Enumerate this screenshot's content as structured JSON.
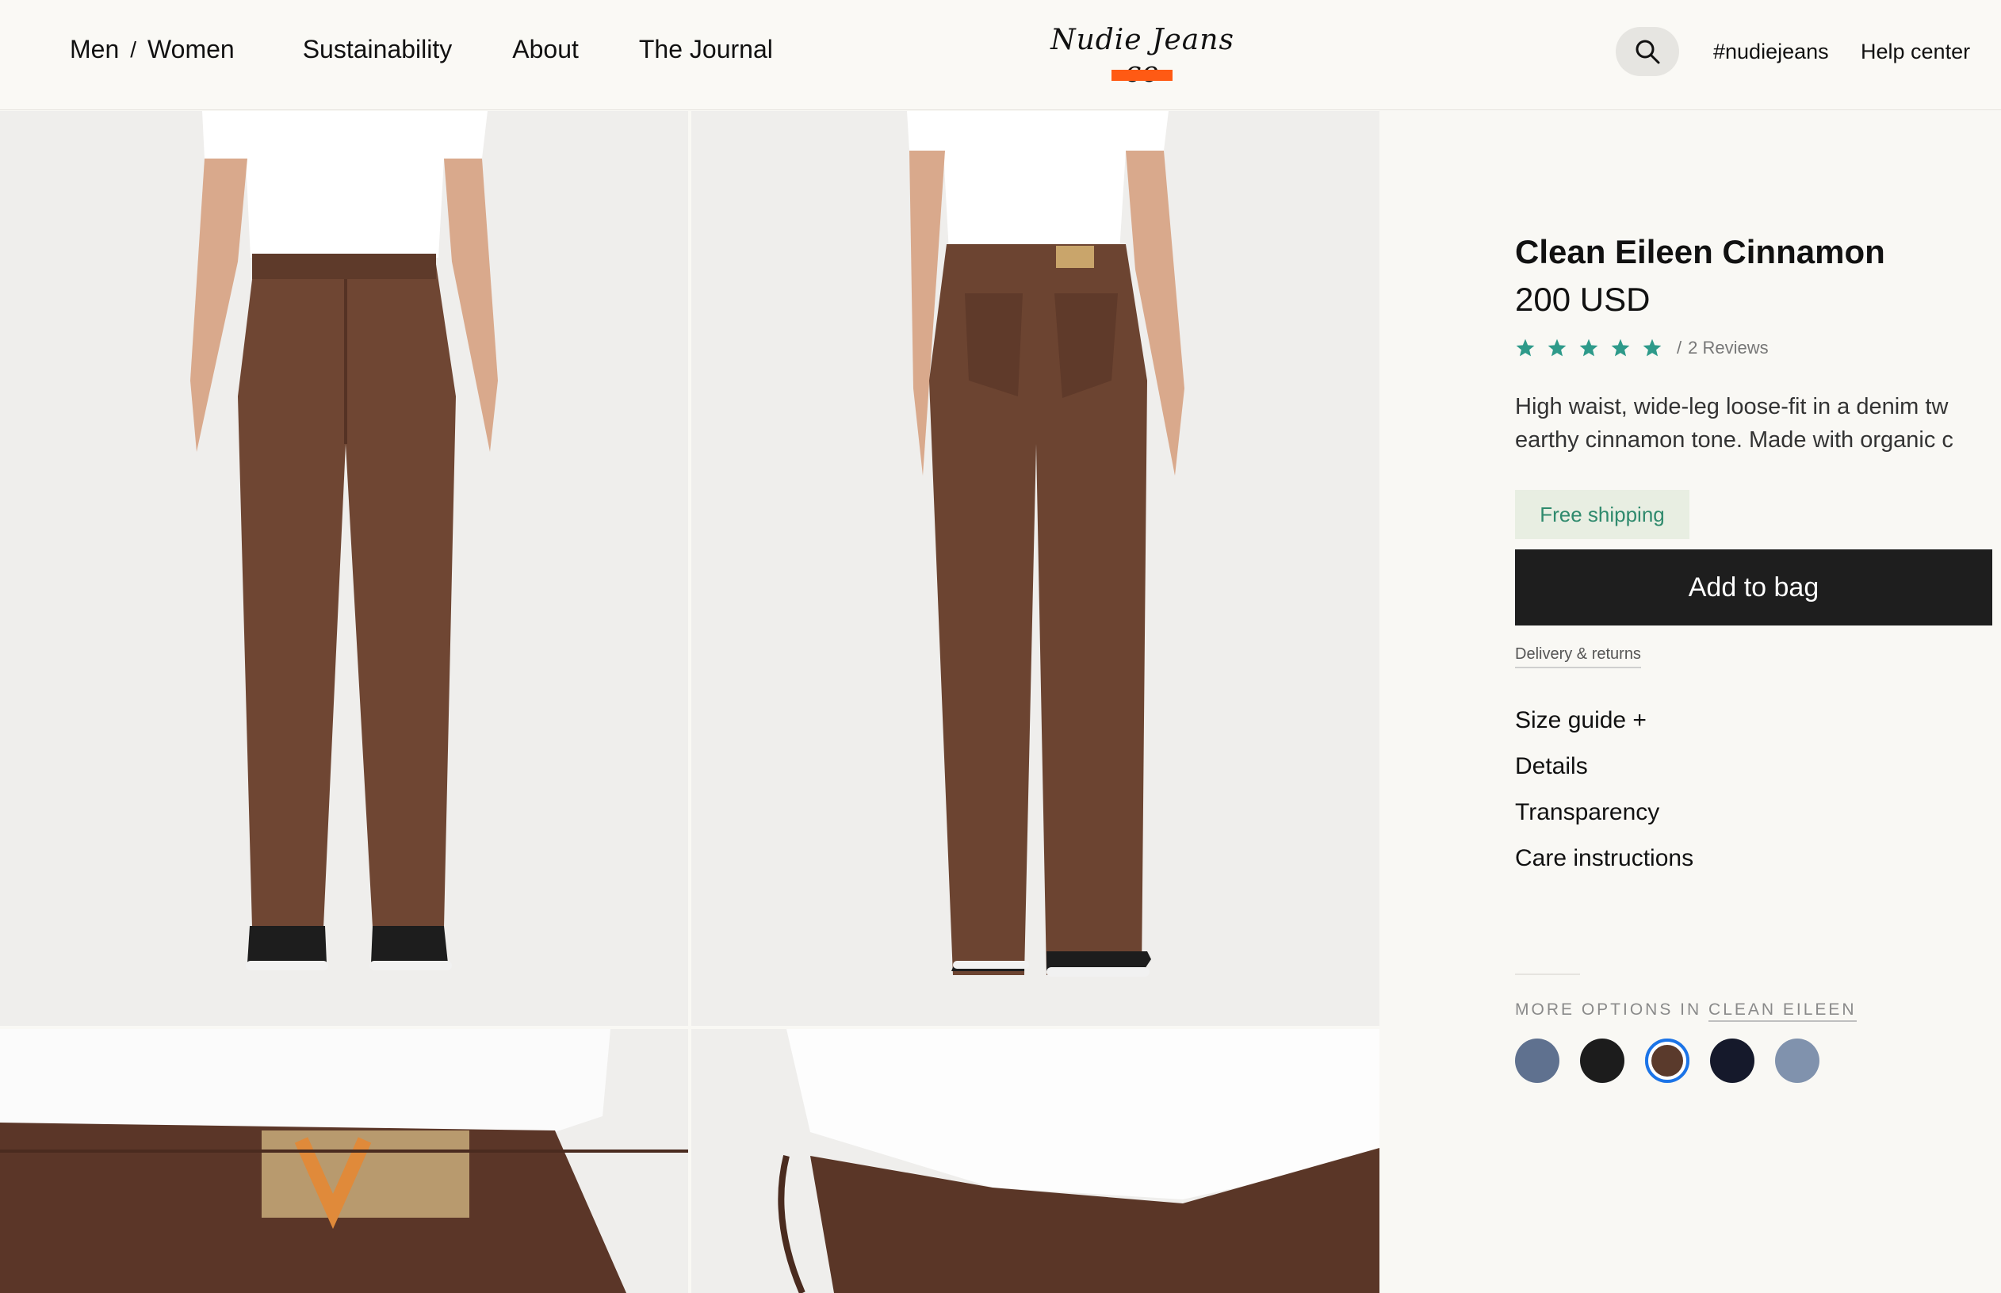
{
  "header": {
    "nav_left": [
      "Men",
      "/",
      "Women",
      "Sustainability",
      "About",
      "The Journal"
    ],
    "logo": "Nudie Jeans co",
    "nav_right": [
      "#nudiejeans",
      "Help center"
    ],
    "icons": {
      "search": "search-icon"
    }
  },
  "gallery": {
    "photos": [
      "front-view",
      "back-view",
      "back-label-closeup",
      "side-fabric-closeup"
    ]
  },
  "product": {
    "title": "Clean Eileen Cinnamon",
    "price": "200 USD",
    "rating": {
      "stars": 5,
      "reviews": "2 Reviews"
    },
    "description_line1": "High waist, wide-leg loose-fit in a denim tw",
    "description_line2": "earthy cinnamon tone. Made with organic c",
    "shipping_badge": "Free shipping",
    "add_to_bag": "Add to bag",
    "delivery_link": "Delivery & returns",
    "accordion": [
      "Size guide +",
      "Details",
      "Transparency",
      "Care instructions"
    ],
    "more_options_label": "MORE OPTIONS IN",
    "more_options_link": "CLEAN EILEEN",
    "swatches": [
      "#5f718f",
      "#1c1c1c",
      "#5a3a2c",
      "#15192b",
      "#8092ad"
    ],
    "selected_swatch": 2
  },
  "colors": {
    "accent": "#ff5a14",
    "star": "#2e9a8a",
    "button": "#1e1e1e"
  }
}
